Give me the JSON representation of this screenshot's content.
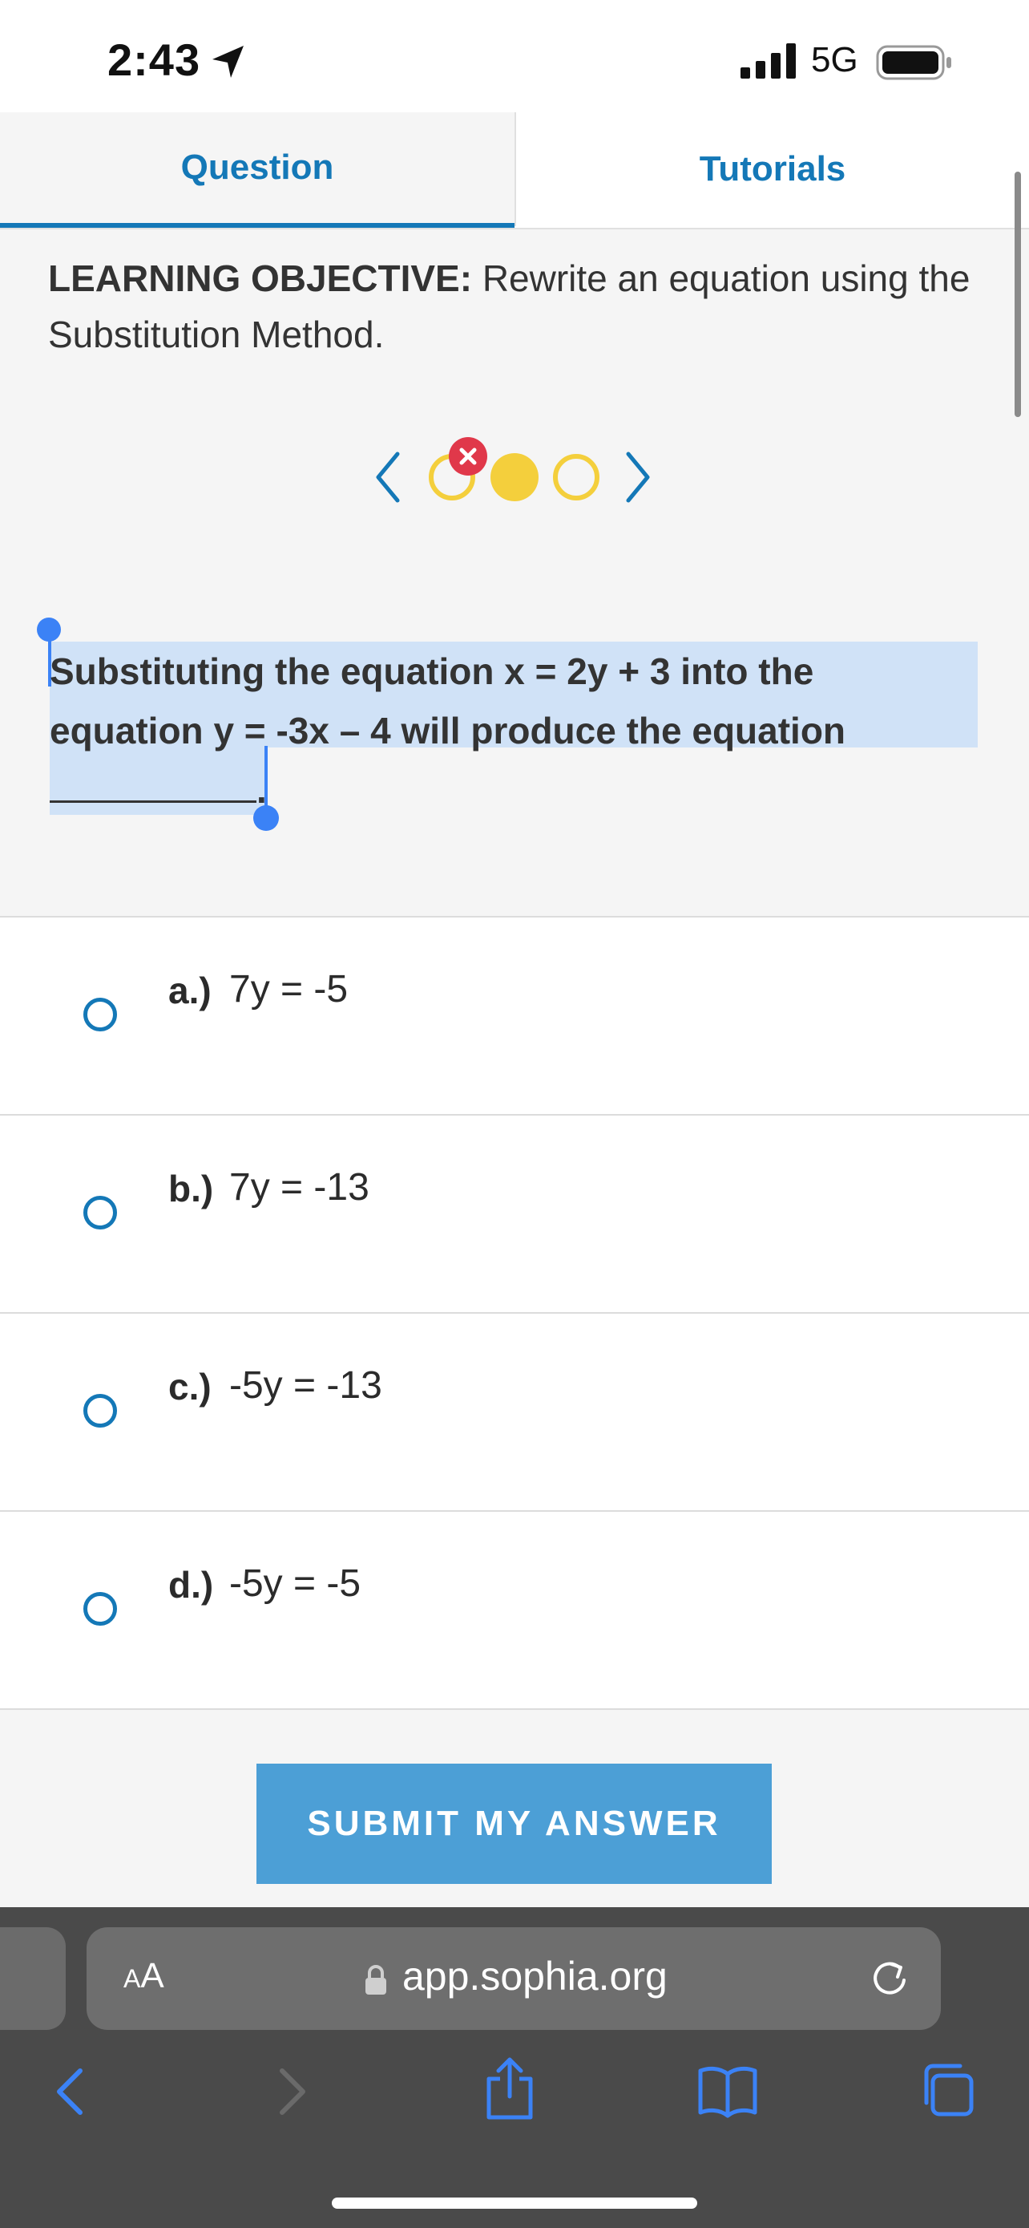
{
  "status": {
    "time": "2:43",
    "network": "5G"
  },
  "tabs": [
    {
      "label": "Question"
    },
    {
      "label": "Tutorials"
    }
  ],
  "objective": {
    "label": "LEARNING OBJECTIVE:",
    "text": " Rewrite an equation using the Substitution Method."
  },
  "progress": {
    "dots": [
      "incorrect",
      "current",
      "empty"
    ]
  },
  "question": {
    "line1": "Substituting the equation x = 2y + 3 into the",
    "line2": "equation y = -3x – 4 will produce the equation",
    "end": "."
  },
  "options": [
    {
      "letter": "a.)",
      "text": "7y = -5"
    },
    {
      "letter": "b.)",
      "text": "7y = -13"
    },
    {
      "letter": "c.)",
      "text": "-5y = -13"
    },
    {
      "letter": "d.)",
      "text": "-5y = -5"
    }
  ],
  "submit_label": "SUBMIT MY ANSWER",
  "browser": {
    "aa": "A",
    "aa_big": "A",
    "url": "app.sophia.org"
  },
  "colors": {
    "accent": "#1478b7",
    "button": "#4c9fd6",
    "dot": "#f4cf3c",
    "error": "#e0384a",
    "selection": "#d0e2f7"
  }
}
